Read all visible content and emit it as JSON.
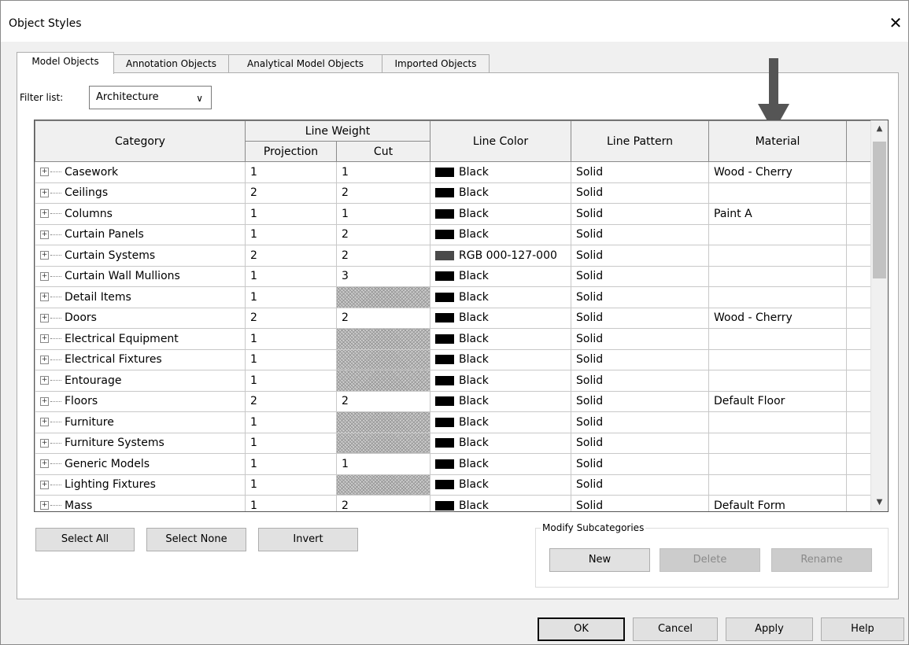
{
  "window": {
    "title": "Object Styles",
    "close_label": "✕"
  },
  "tabs": [
    {
      "label": "Model Objects",
      "active": true
    },
    {
      "label": "Annotation Objects",
      "active": false
    },
    {
      "label": "Analytical Model Objects",
      "active": false
    },
    {
      "label": "Imported Objects",
      "active": false
    }
  ],
  "filter": {
    "label": "Filter list:",
    "value": "Architecture"
  },
  "grid": {
    "headers": {
      "category": "Category",
      "line_weight": "Line Weight",
      "projection": "Projection",
      "cut": "Cut",
      "line_color": "Line Color",
      "line_pattern": "Line Pattern",
      "material": "Material"
    },
    "rows": [
      {
        "category": "Casework",
        "projection": "1",
        "cut": "1",
        "color": "Black",
        "pattern": "Solid",
        "material": "Wood - Cherry"
      },
      {
        "category": "Ceilings",
        "projection": "2",
        "cut": "2",
        "color": "Black",
        "pattern": "Solid",
        "material": ""
      },
      {
        "category": "Columns",
        "projection": "1",
        "cut": "1",
        "color": "Black",
        "pattern": "Solid",
        "material": "Paint A"
      },
      {
        "category": "Curtain Panels",
        "projection": "1",
        "cut": "2",
        "color": "Black",
        "pattern": "Solid",
        "material": ""
      },
      {
        "category": "Curtain Systems",
        "projection": "2",
        "cut": "2",
        "color": "RGB 000-127-000",
        "pattern": "Solid",
        "material": ""
      },
      {
        "category": "Curtain Wall Mullions",
        "projection": "1",
        "cut": "3",
        "color": "Black",
        "pattern": "Solid",
        "material": ""
      },
      {
        "category": "Detail Items",
        "projection": "1",
        "cut": "",
        "color": "Black",
        "pattern": "Solid",
        "material": ""
      },
      {
        "category": "Doors",
        "projection": "2",
        "cut": "2",
        "color": "Black",
        "pattern": "Solid",
        "material": "Wood - Cherry"
      },
      {
        "category": "Electrical Equipment",
        "projection": "1",
        "cut": "",
        "color": "Black",
        "pattern": "Solid",
        "material": ""
      },
      {
        "category": "Electrical Fixtures",
        "projection": "1",
        "cut": "",
        "color": "Black",
        "pattern": "Solid",
        "material": ""
      },
      {
        "category": "Entourage",
        "projection": "1",
        "cut": "",
        "color": "Black",
        "pattern": "Solid",
        "material": ""
      },
      {
        "category": "Floors",
        "projection": "2",
        "cut": "2",
        "color": "Black",
        "pattern": "Solid",
        "material": "Default Floor"
      },
      {
        "category": "Furniture",
        "projection": "1",
        "cut": "",
        "color": "Black",
        "pattern": "Solid",
        "material": ""
      },
      {
        "category": "Furniture Systems",
        "projection": "1",
        "cut": "",
        "color": "Black",
        "pattern": "Solid",
        "material": ""
      },
      {
        "category": "Generic Models",
        "projection": "1",
        "cut": "1",
        "color": "Black",
        "pattern": "Solid",
        "material": ""
      },
      {
        "category": "Lighting Fixtures",
        "projection": "1",
        "cut": "",
        "color": "Black",
        "pattern": "Solid",
        "material": ""
      },
      {
        "category": "Mass",
        "projection": "1",
        "cut": "2",
        "color": "Black",
        "pattern": "Solid",
        "material": "Default Form"
      }
    ]
  },
  "buttons": {
    "select_all": "Select All",
    "select_none": "Select None",
    "invert": "Invert",
    "ok": "OK",
    "cancel": "Cancel",
    "apply": "Apply",
    "help": "Help"
  },
  "subcategories": {
    "label": "Modify Subcategories",
    "new": "New",
    "delete": "Delete",
    "rename": "Rename"
  }
}
